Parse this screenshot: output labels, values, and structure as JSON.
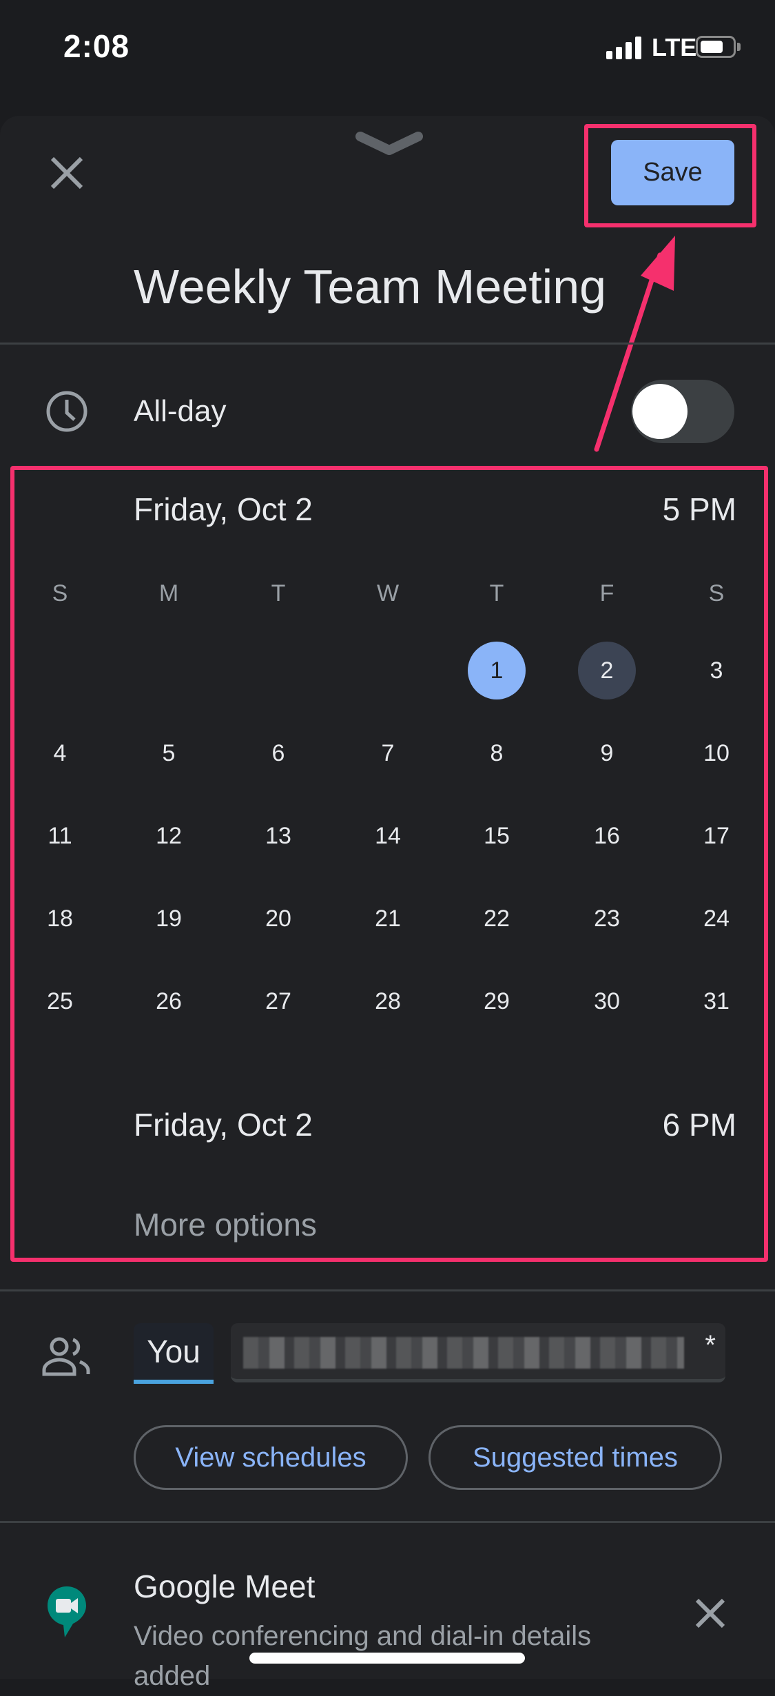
{
  "status_bar": {
    "time": "2:08",
    "network": "LTE",
    "signal_bars": 4,
    "battery_icon": "battery-icon"
  },
  "header": {
    "close_icon": "close-icon",
    "collapse_icon": "chevron-down-icon",
    "save_label": "Save"
  },
  "event": {
    "title": "Weekly Team Meeting"
  },
  "all_day": {
    "label": "All-day",
    "enabled": false,
    "icon": "clock-icon"
  },
  "start": {
    "date": "Friday, Oct 2",
    "time": "5 PM"
  },
  "calendar": {
    "weekdays": [
      "S",
      "M",
      "T",
      "W",
      "T",
      "F",
      "S"
    ],
    "first_weekday_index": 4,
    "days_in_month": 31,
    "today": 1,
    "selected": 2,
    "weeks": [
      [
        "",
        "",
        "",
        "",
        "1",
        "2",
        "3"
      ],
      [
        "4",
        "5",
        "6",
        "7",
        "8",
        "9",
        "10"
      ],
      [
        "11",
        "12",
        "13",
        "14",
        "15",
        "16",
        "17"
      ],
      [
        "18",
        "19",
        "20",
        "21",
        "22",
        "23",
        "24"
      ],
      [
        "25",
        "26",
        "27",
        "28",
        "29",
        "30",
        "31"
      ]
    ]
  },
  "end": {
    "date": "Friday, Oct 2",
    "time": "6 PM"
  },
  "more_options": "More options",
  "guests": {
    "icon": "people-icon",
    "chip_label": "You",
    "field_value_redacted": true,
    "required_marker": "*",
    "view_schedules": "View schedules",
    "suggested_times": "Suggested times"
  },
  "conferencing": {
    "icon": "google-meet-icon",
    "title": "Google Meet",
    "subtitle": "Video conferencing and dial-in details added",
    "remove_icon": "close-icon"
  },
  "annotation": {
    "highlight_color": "#f5306d",
    "accent_color": "#8ab4f8"
  }
}
